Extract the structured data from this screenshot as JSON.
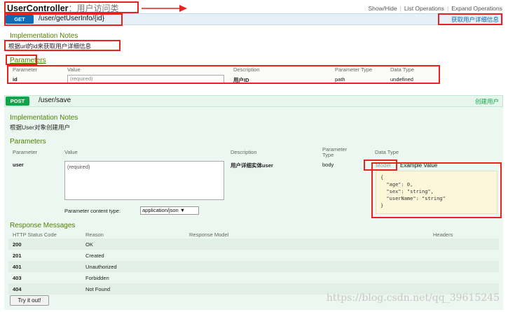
{
  "header": {
    "title": "UserController",
    "title_sub": "：用户访问类",
    "links": [
      "Show/Hide",
      "List Operations",
      "Expand Operations"
    ]
  },
  "get_op": {
    "method": "GET",
    "path": "/user/getUserInfo/{id}",
    "summary": "获取用户详细信息",
    "impl_title": "Implementation Notes",
    "impl_text": "根据url的id来获取用户详细信息",
    "params_title": "Parameters",
    "param_headers": [
      "Parameter",
      "Value",
      "Description",
      "Parameter Type",
      "Data Type"
    ],
    "param": {
      "name": "id",
      "placeholder": "(required)",
      "description": "用户ID",
      "type": "path",
      "data_type": "undefined"
    }
  },
  "post_op": {
    "method": "POST",
    "path": "/user/save",
    "summary": "创建用户",
    "impl_title": "Implementation Notes",
    "impl_text": "根据User对象创建用户",
    "params_title": "Parameters",
    "param_headers": {
      "parameter": "Parameter",
      "value": "Value",
      "description": "Description",
      "param_type_1": "Parameter",
      "param_type_2": "Type",
      "data_type": "Data Type"
    },
    "param": {
      "name": "user",
      "placeholder": "(required)",
      "description": "用户详细实体user",
      "type": "body"
    },
    "content_type_label": "Parameter content type:",
    "content_type_value": "application/json ▼",
    "model_link": "Model",
    "example_tab": "Example Value",
    "example_json": "{\n  \"age\": 0,\n  \"sex\": \"string\",\n  \"userName\": \"string\"\n}",
    "response_title": "Response Messages",
    "response_headers": [
      "HTTP Status Code",
      "Reason",
      "Response Model",
      "Headers"
    ],
    "responses": [
      {
        "code": "200",
        "reason": "OK"
      },
      {
        "code": "201",
        "reason": "Created"
      },
      {
        "code": "401",
        "reason": "Unauthorized"
      },
      {
        "code": "403",
        "reason": "Forbidden"
      },
      {
        "code": "404",
        "reason": "Not Found"
      }
    ],
    "try_button": "Try it out!"
  },
  "watermark": "https://blog.csdn.net/qq_39615245",
  "colors": {
    "get": "#0f6ab4",
    "post": "#10a54a",
    "section_title": "#547f00",
    "annotation": "#e8231e"
  }
}
